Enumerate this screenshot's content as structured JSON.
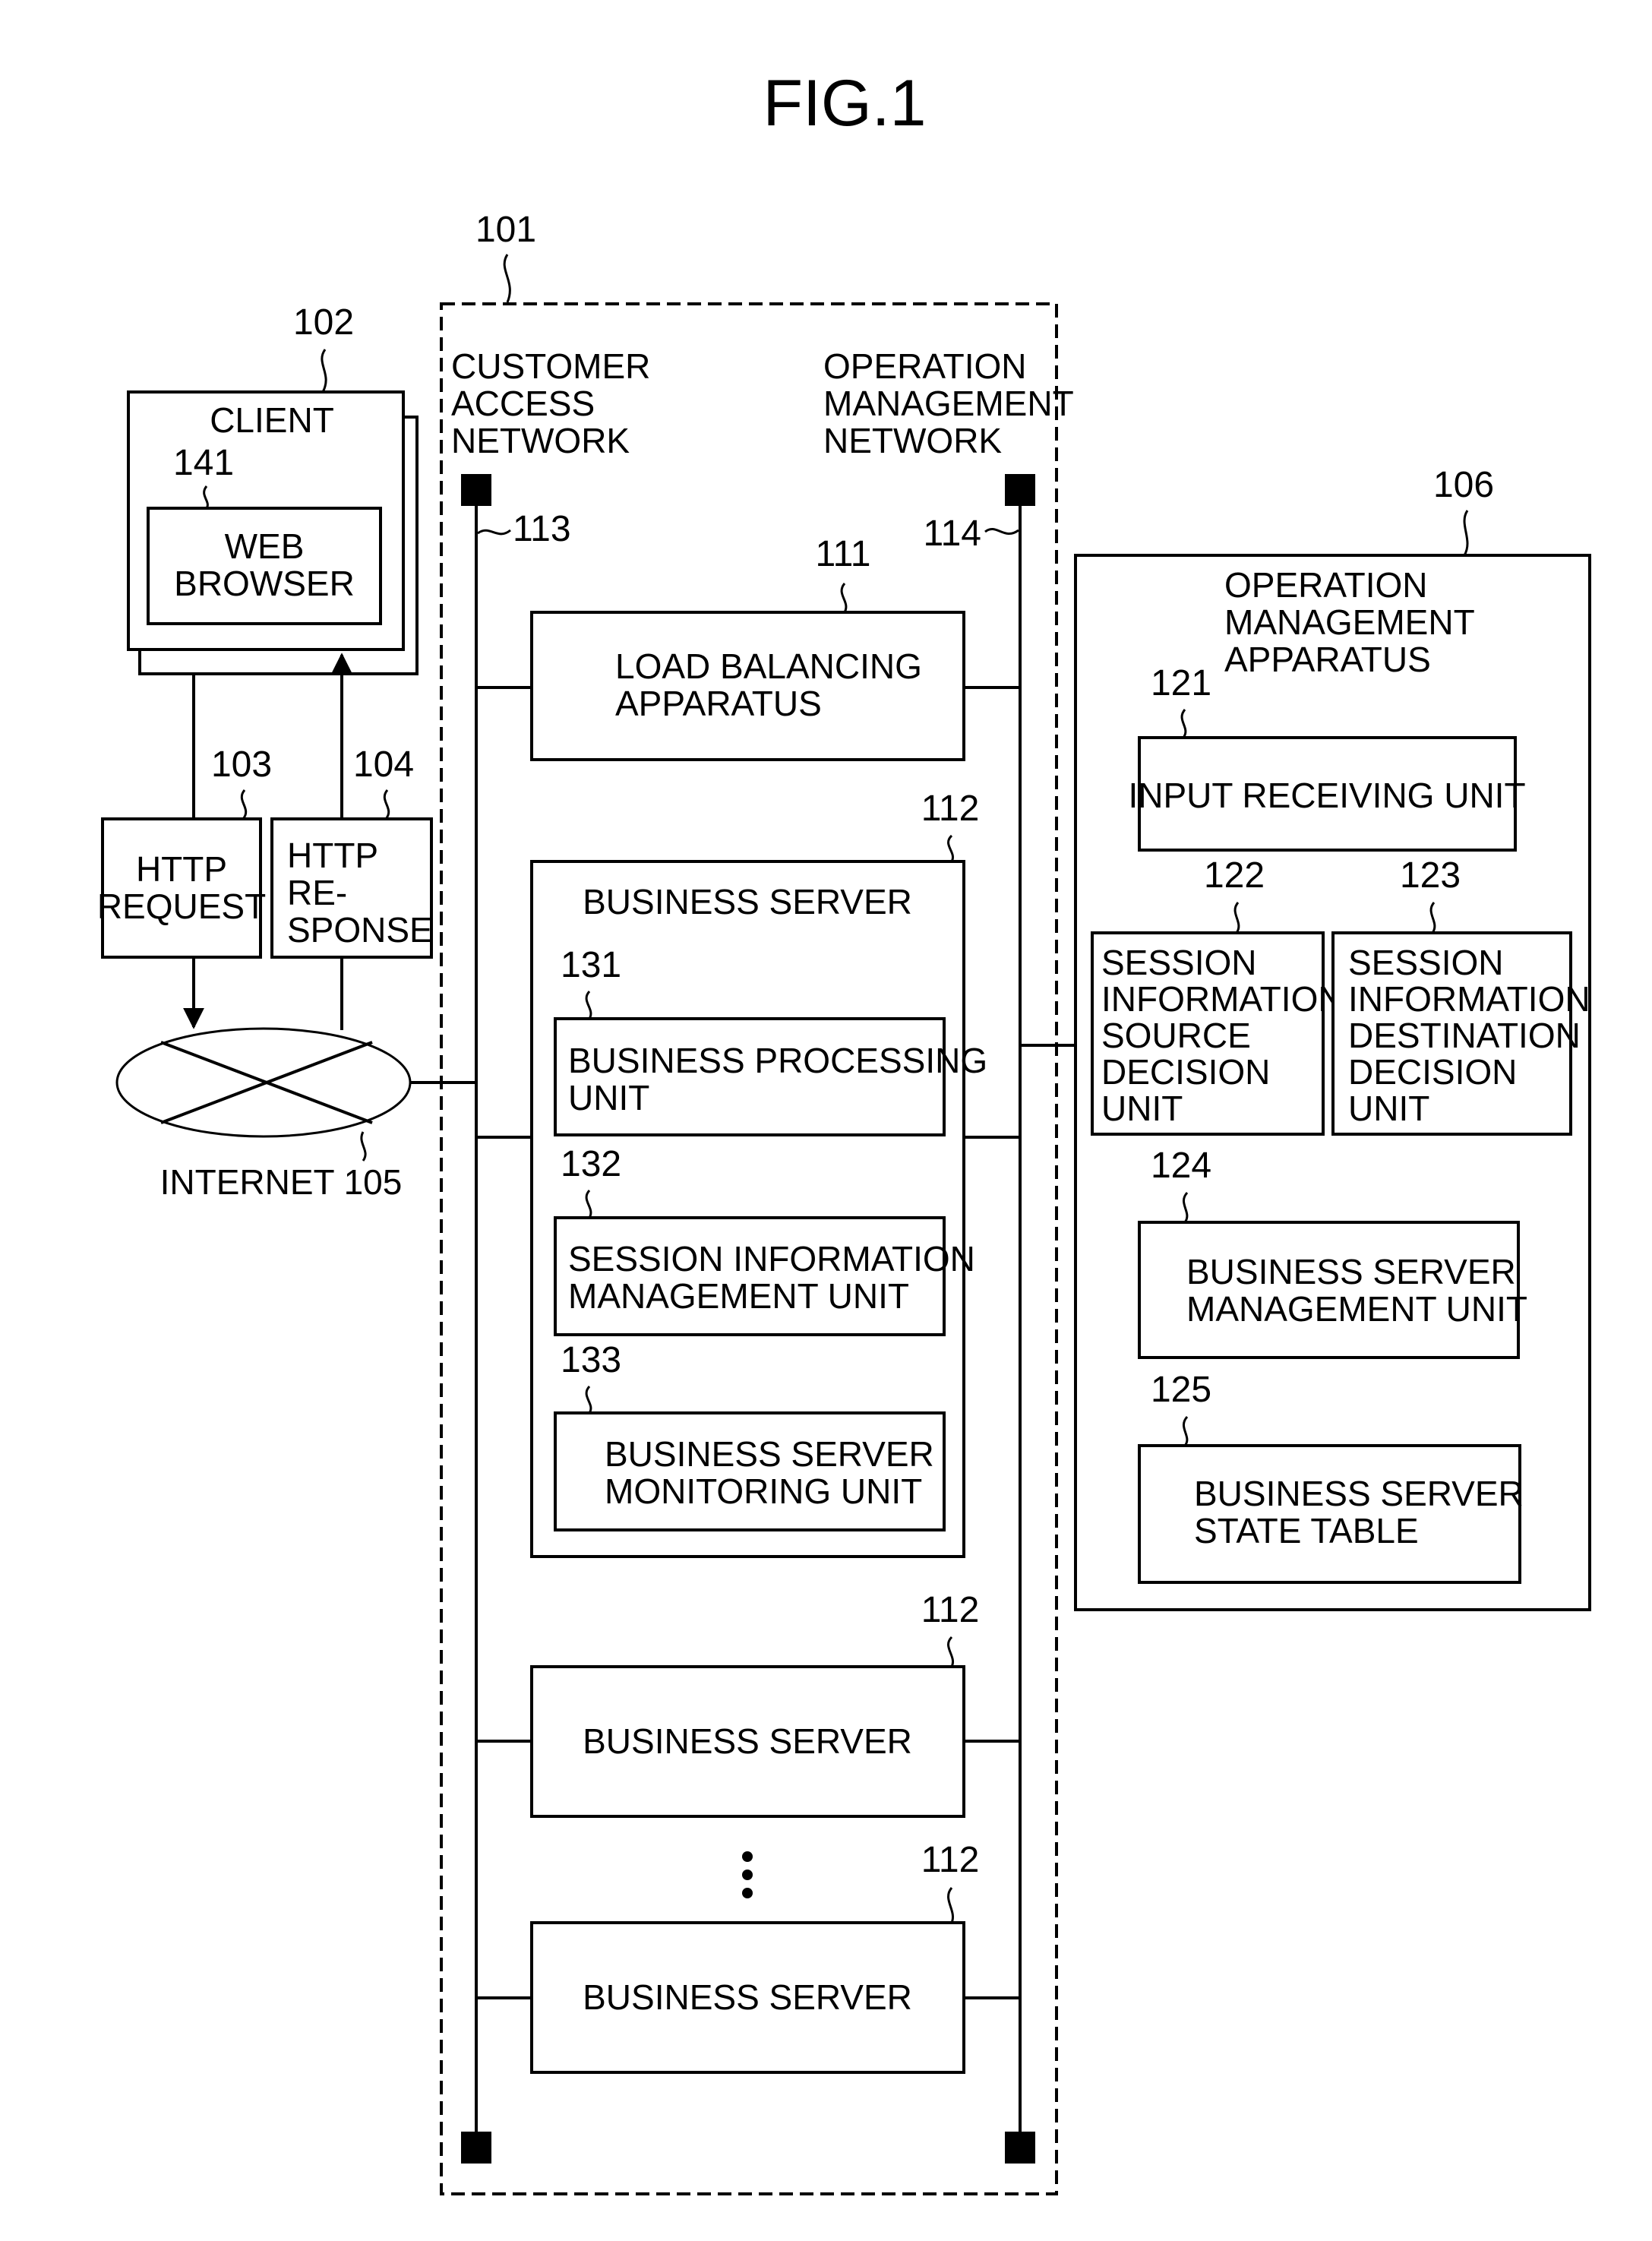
{
  "figure": {
    "title": "FIG.1"
  },
  "system": {
    "ref": "101",
    "customer_network": {
      "lines": [
        "CUSTOMER",
        "ACCESS",
        "NETWORK"
      ],
      "ref": "113"
    },
    "operation_network": {
      "lines": [
        "OPERATION",
        "MANAGEMENT",
        "NETWORK"
      ],
      "ref": "114"
    },
    "load_balancer": {
      "ref": "111",
      "lines": [
        "LOAD BALANCING",
        "APPARATUS"
      ]
    },
    "business_servers": [
      {
        "ref": "112",
        "label": "BUSINESS SERVER",
        "units": [
          {
            "ref": "131",
            "lines": [
              "BUSINESS PROCESSING",
              "UNIT"
            ]
          },
          {
            "ref": "132",
            "lines": [
              "SESSION INFORMATION",
              "MANAGEMENT UNIT"
            ]
          },
          {
            "ref": "133",
            "lines": [
              "BUSINESS SERVER",
              "MONITORING UNIT"
            ]
          }
        ]
      },
      {
        "ref": "112",
        "label": "BUSINESS SERVER"
      },
      {
        "ref": "112",
        "label": "BUSINESS SERVER"
      }
    ],
    "ellipsis": "⋮"
  },
  "client": {
    "ref": "102",
    "label": "CLIENT",
    "browser": {
      "ref": "141",
      "lines": [
        "WEB",
        "BROWSER"
      ]
    }
  },
  "http_request": {
    "ref": "103",
    "lines": [
      "HTTP",
      "REQUEST"
    ]
  },
  "http_response": {
    "ref": "104",
    "lines": [
      "HTTP",
      "RE-",
      "SPONSE"
    ]
  },
  "internet": {
    "label": "INTERNET 105"
  },
  "operation_management": {
    "ref": "106",
    "lines": [
      "OPERATION",
      "MANAGEMENT",
      "APPARATUS"
    ],
    "units": [
      {
        "ref": "121",
        "lines": [
          "INPUT RECEIVING UNIT"
        ]
      },
      {
        "ref": "122",
        "lines": [
          "SESSION",
          "INFORMATION",
          "SOURCE",
          "DECISION",
          "UNIT"
        ]
      },
      {
        "ref": "123",
        "lines": [
          "SESSION",
          "INFORMATION",
          "DESTINATION",
          "DECISION",
          "UNIT"
        ]
      },
      {
        "ref": "124",
        "lines": [
          "BUSINESS SERVER",
          "MANAGEMENT UNIT"
        ]
      },
      {
        "ref": "125",
        "lines": [
          "BUSINESS SERVER",
          "STATE TABLE"
        ]
      }
    ]
  }
}
